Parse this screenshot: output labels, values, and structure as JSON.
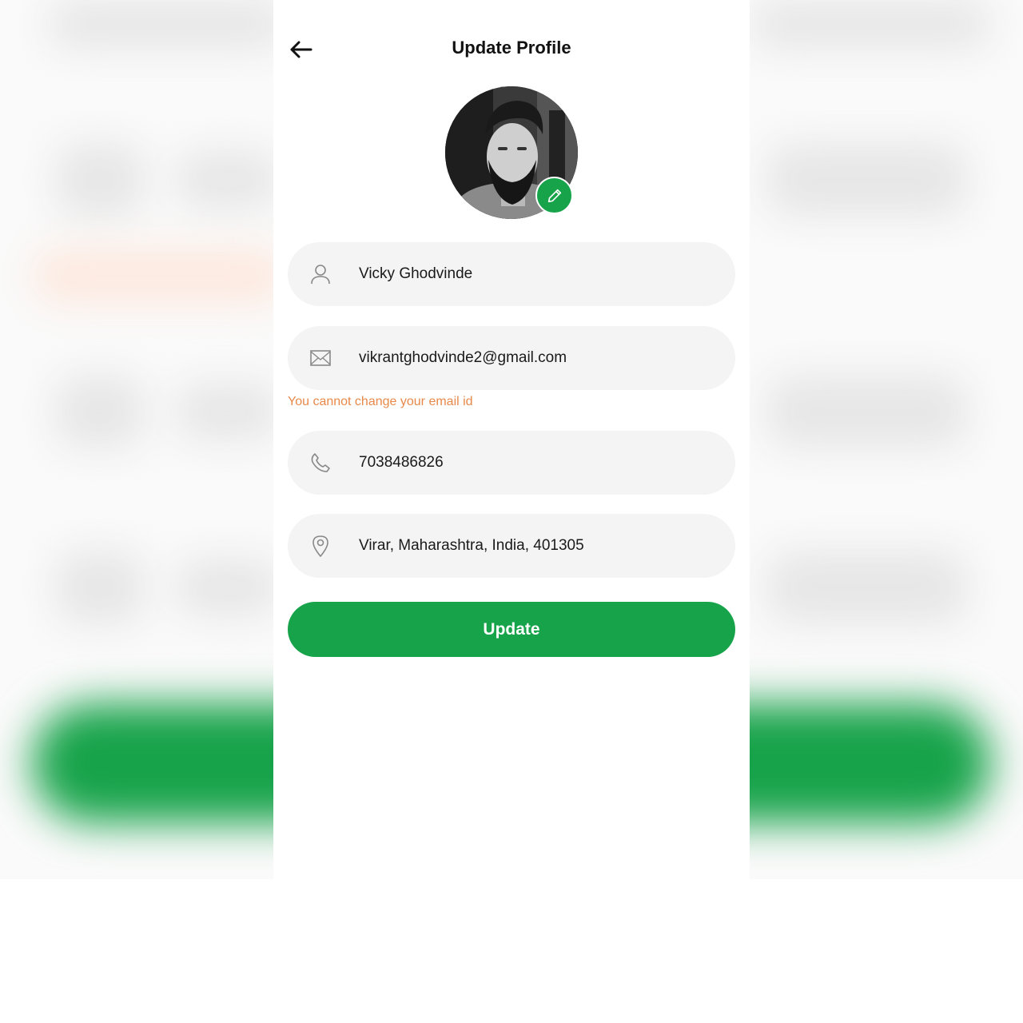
{
  "header": {
    "title": "Update Profile",
    "back_icon": "arrow-left-icon"
  },
  "avatar": {
    "edit_icon": "pencil-icon"
  },
  "form": {
    "name": {
      "value": "Vicky Ghodvinde",
      "icon": "user-icon"
    },
    "email": {
      "value": "vikrantghodvinde2@gmail.com",
      "icon": "mail-icon"
    },
    "email_hint": "You cannot change your email id",
    "phone": {
      "value": "7038486826",
      "icon": "phone-icon"
    },
    "address": {
      "value": "Virar, Maharashtra, India, 401305",
      "icon": "location-pin-icon"
    }
  },
  "actions": {
    "update_label": "Update"
  },
  "colors": {
    "primary": "#17a34a",
    "field_bg": "#f4f4f4",
    "hint": "#e8894a",
    "text": "#1a1a1a"
  }
}
